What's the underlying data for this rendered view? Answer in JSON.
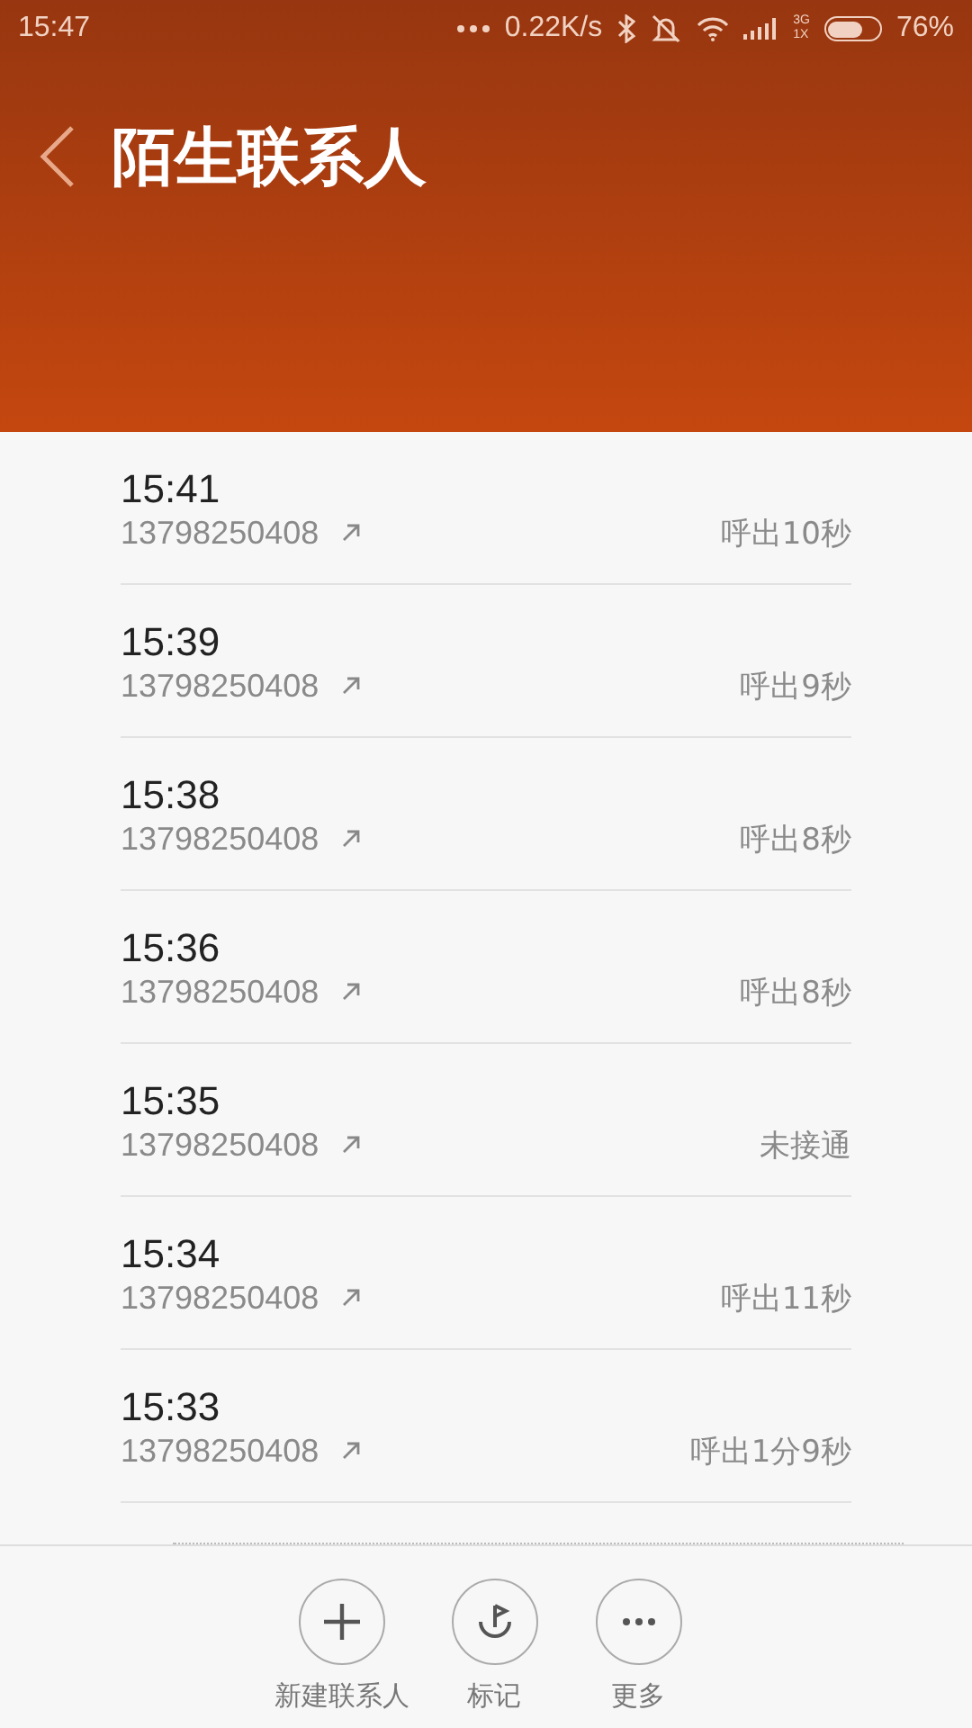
{
  "status_bar": {
    "time": "15:47",
    "speed": "0.22K/s",
    "network": [
      "3G",
      "1X"
    ],
    "battery": "76%"
  },
  "header": {
    "title": "陌生联系人"
  },
  "calls": [
    {
      "time": "15:41",
      "number": "13798250408",
      "outgoing": true,
      "result": "呼出10秒"
    },
    {
      "time": "15:39",
      "number": "13798250408",
      "outgoing": true,
      "result": "呼出9秒"
    },
    {
      "time": "15:38",
      "number": "13798250408",
      "outgoing": true,
      "result": "呼出8秒"
    },
    {
      "time": "15:36",
      "number": "13798250408",
      "outgoing": true,
      "result": "呼出8秒"
    },
    {
      "time": "15:35",
      "number": "13798250408",
      "outgoing": true,
      "result": "未接通"
    },
    {
      "time": "15:34",
      "number": "13798250408",
      "outgoing": true,
      "result": "呼出11秒"
    },
    {
      "time": "15:33",
      "number": "13798250408",
      "outgoing": true,
      "result": "呼出1分9秒"
    }
  ],
  "actions": [
    {
      "kind": "add",
      "label": "新建联系人"
    },
    {
      "kind": "mark",
      "label": "标记"
    },
    {
      "kind": "more",
      "label": "更多"
    }
  ]
}
